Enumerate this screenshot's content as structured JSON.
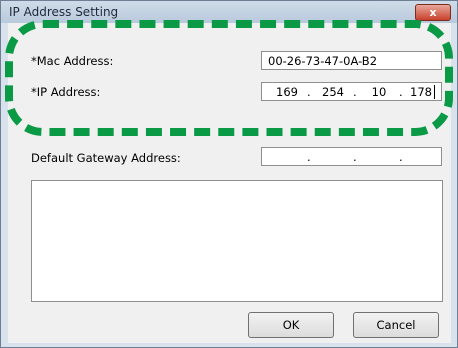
{
  "window": {
    "title": "IP Address Setting",
    "close_label": "x"
  },
  "form": {
    "mac_label": "*Mac Address:",
    "mac_value": "00-26-73-47-0A-B2",
    "ip_label": "*IP Address:",
    "ip_octets": [
      "169",
      "254",
      "10",
      "178"
    ],
    "gateway_label": "Default Gateway Address:",
    "gateway_octets": [
      "",
      "",
      "",
      ""
    ]
  },
  "buttons": {
    "ok_label": "OK",
    "cancel_label": "Cancel"
  },
  "colors": {
    "highlight": "#0a9a46"
  }
}
